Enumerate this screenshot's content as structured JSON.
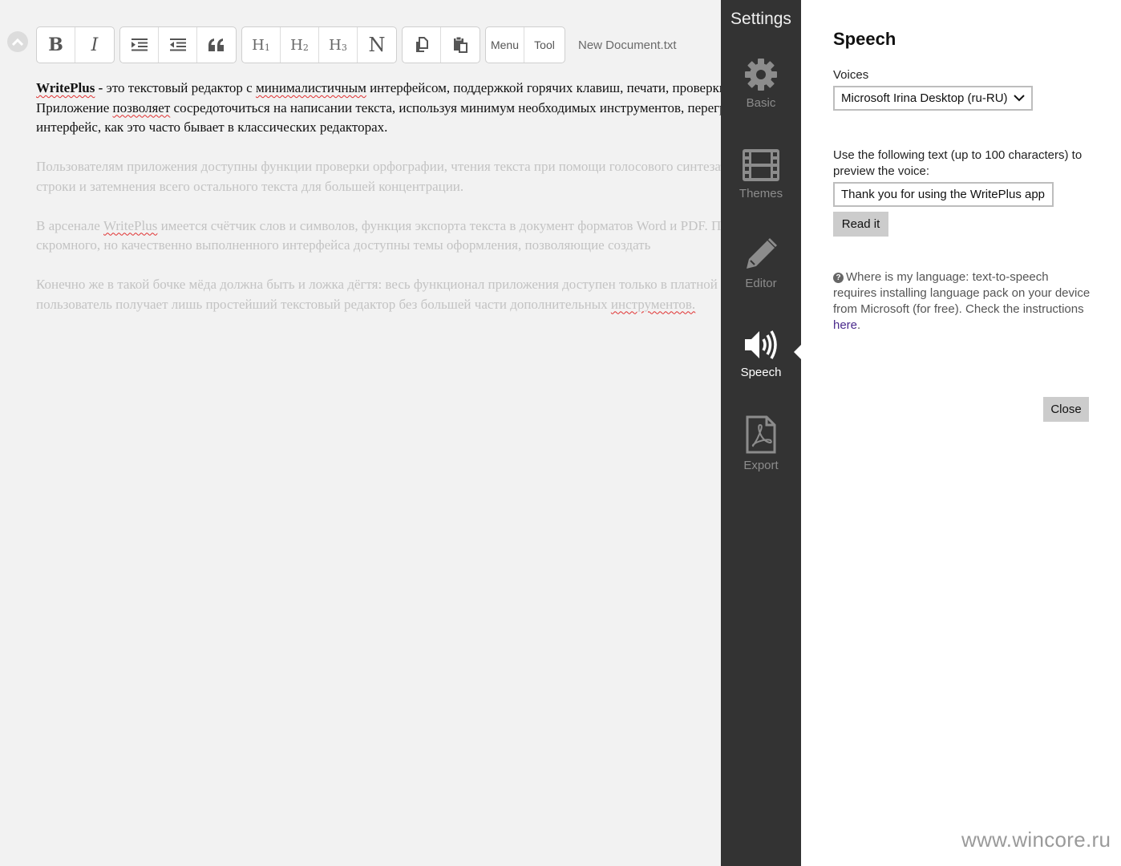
{
  "editor": {
    "document_name": "New Document.txt",
    "toolbar": {
      "bold": "B",
      "italic": "I",
      "h1": "H",
      "h1_sub": "1",
      "h2": "H",
      "h2_sub": "2",
      "h3": "H",
      "h3_sub": "3",
      "normal": "N",
      "menu": "Menu",
      "tool": "Tool"
    },
    "paragraphs": [
      {
        "line1_bold": "WritePlus",
        "line1_dash": " - ",
        "line1_a": "это текстовый редактор с ",
        "line1_b": "минималистичным",
        "line1_c": " интерфейсом, поддержкой горячих клавиш, печати, проверки орфографии.",
        "line2_a": "Приложение ",
        "line2_b": "позволяет",
        "line2_c": " сосредоточиться на написании текста, используя минимум необходимых инструментов, перегружающих",
        "line3": "интерфейс, как это часто бывает в классических редакторах."
      },
      {
        "line1": "Пользователям приложения доступны функции проверки орфографии, чтения текста при помощи голосового синтезатора, выделения",
        "line2": "строки и затемнения всего остального текста для большей концентрации."
      },
      {
        "line1_a": "В арсенале ",
        "line1_b": "WritePlus",
        "line1_c": " имеется счётчик слов и символов, функция экспорта текста в документ форматов Word и PDF. Помимо",
        "line2": "скромного, но качественно выполненного интерфейса доступны темы оформления, позволяющие создать"
      },
      {
        "line1": "Конечно же в такой бочке мёда должна быть и ложка дёгтя: весь функционал приложения доступен только в платной версии,",
        "line2_a": "пользователь получает лишь простейший текстовый редактор без большей части дополнительных ",
        "line2_b": "инструментов."
      }
    ]
  },
  "settings": {
    "title": "Settings",
    "items": [
      {
        "label": "Basic",
        "icon": "gear-icon"
      },
      {
        "label": "Themes",
        "icon": "film-icon"
      },
      {
        "label": "Editor",
        "icon": "pencil-icon"
      },
      {
        "label": "Speech",
        "icon": "speaker-icon"
      },
      {
        "label": "Export",
        "icon": "pdf-icon"
      }
    ]
  },
  "speech": {
    "title": "Speech",
    "voices_label": "Voices",
    "voices_selected": "Microsoft Irina Desktop (ru-RU)",
    "preview_label": "Use the following text (up to 100 characters) to preview the voice:",
    "preview_value": "Thank you for using the WritePlus app",
    "read_button": "Read it",
    "help_text": "Where is my language: text-to-speech requires installing language pack on your device from Microsoft (for free). Check the instructions ",
    "help_link": "here",
    "help_end": ".",
    "close_button": "Close"
  },
  "watermark": "www.wincore.ru"
}
